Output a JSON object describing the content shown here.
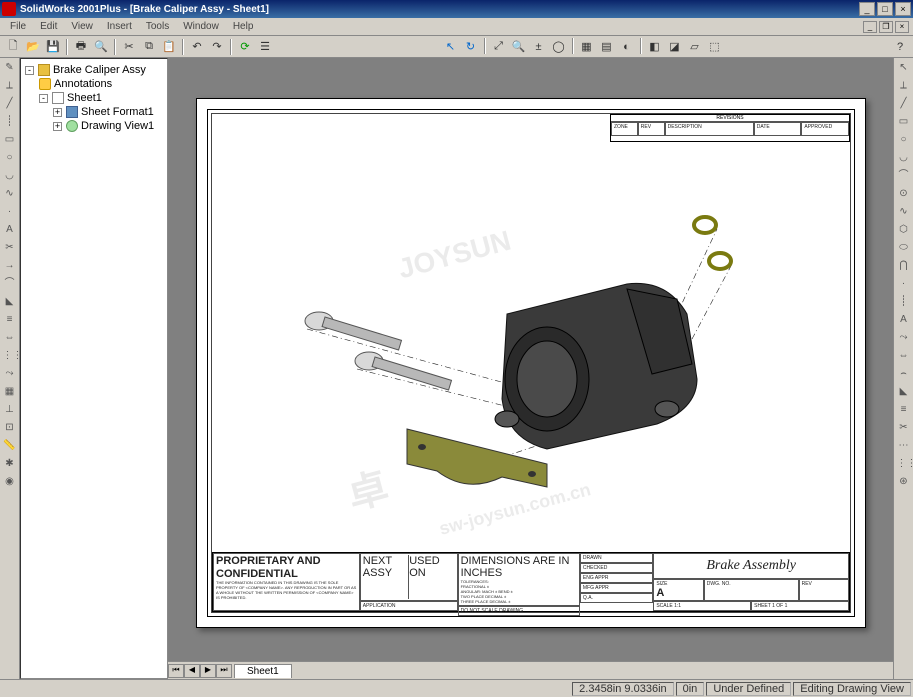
{
  "app": {
    "title": "SolidWorks 2001Plus - [Brake Caliper Assy - Sheet1]"
  },
  "menu": {
    "items": [
      "File",
      "Edit",
      "View",
      "Insert",
      "Tools",
      "Window",
      "Help"
    ]
  },
  "tree": {
    "root": "Brake Caliper Assy",
    "annotations": "Annotations",
    "sheet": "Sheet1",
    "format": "Sheet Format1",
    "view": "Drawing View1"
  },
  "drawing": {
    "title": "Brake Assembly",
    "revblock_label": "REVISIONS",
    "notes_header": "PROPRIETARY AND CONFIDENTIAL",
    "dims_header": "DIMENSIONS ARE IN INCHES",
    "application": "APPLICATION",
    "nextassy": "NEXT ASSY",
    "usedon": "USED ON",
    "dns": "DO NOT SCALE DRAWING",
    "size": "A",
    "scale": "SCALE 1:1",
    "sheet_of": "SHEET 1 OF 1"
  },
  "sheettab": "Sheet1",
  "status": {
    "coords": "2.3458in 9.0336in",
    "z": "0in",
    "definition": "Under Defined",
    "mode": "Editing Drawing View"
  },
  "watermark": {
    "a": "JOYSUN",
    "b": "sw-joysun.com.cn",
    "c": "卓"
  }
}
